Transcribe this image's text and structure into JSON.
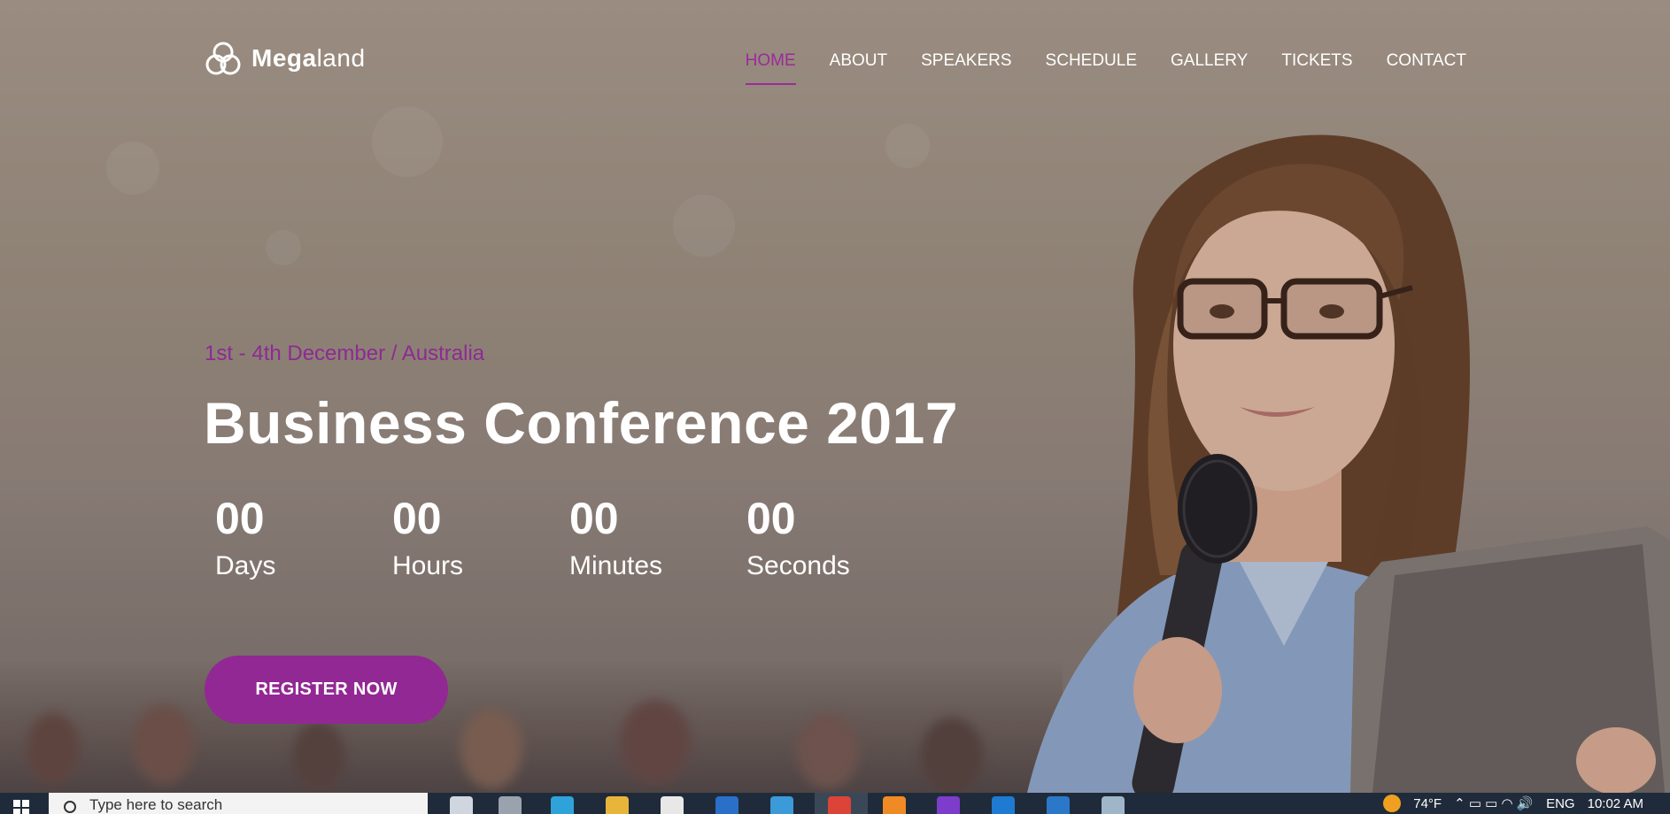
{
  "brand": {
    "name_bold": "Mega",
    "name_light": "land"
  },
  "nav": {
    "items": [
      {
        "label": "HOME",
        "active": true
      },
      {
        "label": "ABOUT"
      },
      {
        "label": "SPEAKERS"
      },
      {
        "label": "SCHEDULE"
      },
      {
        "label": "GALLERY"
      },
      {
        "label": "TICKETS"
      },
      {
        "label": "CONTACT"
      }
    ]
  },
  "hero": {
    "subtitle": "1st - 4th December / Australia",
    "title": "Business Conference 2017",
    "countdown": [
      {
        "value": "00",
        "label": "Days"
      },
      {
        "value": "00",
        "label": "Hours"
      },
      {
        "value": "00",
        "label": "Minutes"
      },
      {
        "value": "00",
        "label": "Seconds"
      }
    ],
    "cta": "REGISTER NOW"
  },
  "taskbar": {
    "search_placeholder": "Type here to search",
    "weather": "74°F",
    "language": "ENG",
    "time": "10:02 AM"
  },
  "colors": {
    "accent": "#922893",
    "nav_active": "#9b2a9b",
    "taskbar": "#1f2b3a"
  }
}
